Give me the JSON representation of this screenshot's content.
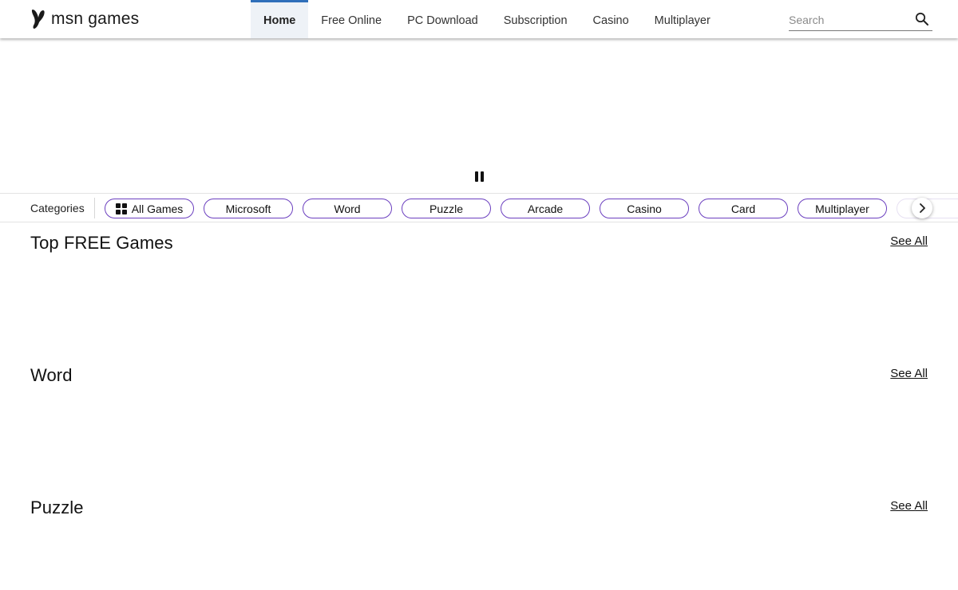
{
  "header": {
    "logo_text": "msn games",
    "nav": [
      "Home",
      "Free Online",
      "PC Download",
      "Subscription",
      "Casino",
      "Multiplayer"
    ],
    "active_nav": "Home",
    "search_placeholder": "Search"
  },
  "categories": {
    "label": "Categories",
    "chips": [
      "All Games",
      "Microsoft",
      "Word",
      "Puzzle",
      "Arcade",
      "Casino",
      "Card",
      "Multiplayer"
    ]
  },
  "sections": [
    {
      "title": "Top FREE Games",
      "link": "See All"
    },
    {
      "title": "Word",
      "link": "See All"
    },
    {
      "title": "Puzzle",
      "link": "See All"
    }
  ],
  "colors": {
    "chip_border": "#6b3fbf",
    "nav_active_bar": "#2f6fba",
    "nav_active_bg": "#eef2f7"
  },
  "icons": {
    "logo": "msn-butterfly-icon",
    "search": "search-icon",
    "pause": "pause-icon",
    "all_games": "grid-icon",
    "next": "chevron-right-icon"
  }
}
